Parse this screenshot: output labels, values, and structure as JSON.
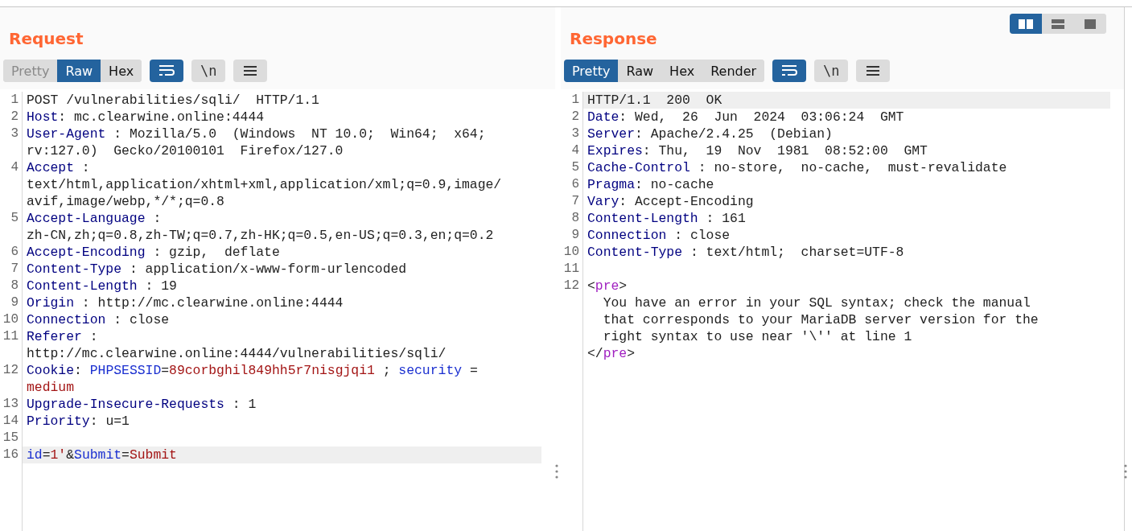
{
  "layout_toggle": [
    {
      "kind": "side-by-side",
      "selected": true
    },
    {
      "kind": "stacked",
      "selected": false
    },
    {
      "kind": "single",
      "selected": false
    }
  ],
  "panes": [
    {
      "title": "Request",
      "view_tabs": [
        {
          "label": "Pretty",
          "selected": false,
          "disabled": true
        },
        {
          "label": "Raw",
          "selected": true,
          "disabled": false
        },
        {
          "label": "Hex",
          "selected": false,
          "disabled": false
        }
      ],
      "tools": [
        {
          "kind": "wrap",
          "selected": true
        },
        {
          "kind": "newline",
          "label": "\\n",
          "selected": false
        },
        {
          "kind": "menu",
          "selected": false
        }
      ],
      "lines": [
        {
          "number": "1",
          "highlighted": false,
          "rows": [
            {
              "parts": [
                {
                  "kind": "plain",
                  "text": "POST /vulnerabilities/sqli/  HTTP/1.1"
                }
              ]
            }
          ]
        },
        {
          "number": "2",
          "highlighted": false,
          "rows": [
            {
              "parts": [
                {
                  "kind": "key",
                  "text": "Host"
                },
                {
                  "kind": "plain",
                  "text": ": mc.clearwine.online:4444"
                }
              ]
            }
          ]
        },
        {
          "number": "3",
          "highlighted": false,
          "rows": [
            {
              "parts": [
                {
                  "kind": "key",
                  "text": "User-Agent"
                },
                {
                  "kind": "plain",
                  "text": " : Mozilla/5.0  (Windows  NT 10.0;  Win64;  x64;"
                }
              ]
            },
            {
              "parts": [
                {
                  "kind": "plain",
                  "text": "rv:127.0)  Gecko/20100101  Firefox/127.0"
                }
              ]
            }
          ]
        },
        {
          "number": "4",
          "highlighted": false,
          "rows": [
            {
              "parts": [
                {
                  "kind": "key",
                  "text": "Accept"
                },
                {
                  "kind": "plain",
                  "text": " :"
                }
              ]
            },
            {
              "parts": [
                {
                  "kind": "plain",
                  "text": "text/html,application/xhtml+xml,application/xml;q=0.9,image/"
                }
              ]
            },
            {
              "parts": [
                {
                  "kind": "plain",
                  "text": "avif,image/webp,*/*;q=0.8"
                }
              ]
            }
          ]
        },
        {
          "number": "5",
          "highlighted": false,
          "rows": [
            {
              "parts": [
                {
                  "kind": "key",
                  "text": "Accept-Language"
                },
                {
                  "kind": "plain",
                  "text": " :"
                }
              ]
            },
            {
              "parts": [
                {
                  "kind": "plain",
                  "text": "zh-CN,zh;q=0.8,zh-TW;q=0.7,zh-HK;q=0.5,en-US;q=0.3,en;q=0.2"
                }
              ]
            }
          ]
        },
        {
          "number": "6",
          "highlighted": false,
          "rows": [
            {
              "parts": [
                {
                  "kind": "key",
                  "text": "Accept-Encoding"
                },
                {
                  "kind": "plain",
                  "text": " : gzip,  deflate"
                }
              ]
            }
          ]
        },
        {
          "number": "7",
          "highlighted": false,
          "rows": [
            {
              "parts": [
                {
                  "kind": "key",
                  "text": "Content-Type"
                },
                {
                  "kind": "plain",
                  "text": " : application/x-www-form-urlencoded"
                }
              ]
            }
          ]
        },
        {
          "number": "8",
          "highlighted": false,
          "rows": [
            {
              "parts": [
                {
                  "kind": "key",
                  "text": "Content-Length"
                },
                {
                  "kind": "plain",
                  "text": " : 19"
                }
              ]
            }
          ]
        },
        {
          "number": "9",
          "highlighted": false,
          "rows": [
            {
              "parts": [
                {
                  "kind": "key",
                  "text": "Origin"
                },
                {
                  "kind": "plain",
                  "text": " : http://mc.clearwine.online:4444"
                }
              ]
            }
          ]
        },
        {
          "number": "10",
          "highlighted": false,
          "rows": [
            {
              "parts": [
                {
                  "kind": "key",
                  "text": "Connection"
                },
                {
                  "kind": "plain",
                  "text": " : close"
                }
              ]
            }
          ]
        },
        {
          "number": "11",
          "highlighted": false,
          "rows": [
            {
              "parts": [
                {
                  "kind": "key",
                  "text": "Referer"
                },
                {
                  "kind": "plain",
                  "text": " :"
                }
              ]
            },
            {
              "parts": [
                {
                  "kind": "plain",
                  "text": "http://mc.clearwine.online:4444/vulnerabilities/sqli/"
                }
              ]
            }
          ]
        },
        {
          "number": "12",
          "highlighted": false,
          "rows": [
            {
              "parts": [
                {
                  "kind": "key",
                  "text": "Cookie"
                },
                {
                  "kind": "plain",
                  "text": ": "
                },
                {
                  "kind": "name",
                  "text": "PHPSESSID"
                },
                {
                  "kind": "plain",
                  "text": "="
                },
                {
                  "kind": "value",
                  "text": "89corbghil849hh5r7nisgjqi1"
                },
                {
                  "kind": "plain",
                  "text": " ; "
                },
                {
                  "kind": "name",
                  "text": "security"
                },
                {
                  "kind": "plain",
                  "text": " ="
                }
              ]
            },
            {
              "parts": [
                {
                  "kind": "value",
                  "text": "medium"
                }
              ]
            }
          ]
        },
        {
          "number": "13",
          "highlighted": false,
          "rows": [
            {
              "parts": [
                {
                  "kind": "key",
                  "text": "Upgrade-Insecure-Requests"
                },
                {
                  "kind": "plain",
                  "text": " : 1"
                }
              ]
            }
          ]
        },
        {
          "number": "14",
          "highlighted": false,
          "rows": [
            {
              "parts": [
                {
                  "kind": "key",
                  "text": "Priority"
                },
                {
                  "kind": "plain",
                  "text": ": u=1"
                }
              ]
            }
          ]
        },
        {
          "number": "15",
          "highlighted": false,
          "rows": [
            {
              "parts": []
            }
          ]
        },
        {
          "number": "16",
          "highlighted": true,
          "rows": [
            {
              "parts": [
                {
                  "kind": "name",
                  "text": "id"
                },
                {
                  "kind": "plain",
                  "text": "="
                },
                {
                  "kind": "value",
                  "text": "1'"
                },
                {
                  "kind": "plain",
                  "text": "&"
                },
                {
                  "kind": "name",
                  "text": "Submit"
                },
                {
                  "kind": "plain",
                  "text": "="
                },
                {
                  "kind": "value",
                  "text": "Submit"
                }
              ]
            }
          ]
        }
      ]
    },
    {
      "title": "Response",
      "view_tabs": [
        {
          "label": "Pretty",
          "selected": true,
          "disabled": false
        },
        {
          "label": "Raw",
          "selected": false,
          "disabled": false
        },
        {
          "label": "Hex",
          "selected": false,
          "disabled": false
        },
        {
          "label": "Render",
          "selected": false,
          "disabled": false
        }
      ],
      "tools": [
        {
          "kind": "wrap",
          "selected": true
        },
        {
          "kind": "newline",
          "label": "\\n",
          "selected": false
        },
        {
          "kind": "menu",
          "selected": false
        }
      ],
      "lines": [
        {
          "number": "1",
          "highlighted": true,
          "rows": [
            {
              "parts": [
                {
                  "kind": "plain",
                  "text": "HTTP/1.1  200  OK"
                }
              ]
            }
          ]
        },
        {
          "number": "2",
          "highlighted": false,
          "rows": [
            {
              "parts": [
                {
                  "kind": "key",
                  "text": "Date"
                },
                {
                  "kind": "plain",
                  "text": ": Wed,  26  Jun  2024  03:06:24  GMT"
                }
              ]
            }
          ]
        },
        {
          "number": "3",
          "highlighted": false,
          "rows": [
            {
              "parts": [
                {
                  "kind": "key",
                  "text": "Server"
                },
                {
                  "kind": "plain",
                  "text": ": Apache/2.4.25  (Debian)"
                }
              ]
            }
          ]
        },
        {
          "number": "4",
          "highlighted": false,
          "rows": [
            {
              "parts": [
                {
                  "kind": "key",
                  "text": "Expires"
                },
                {
                  "kind": "plain",
                  "text": ": Thu,  19  Nov  1981  08:52:00  GMT"
                }
              ]
            }
          ]
        },
        {
          "number": "5",
          "highlighted": false,
          "rows": [
            {
              "parts": [
                {
                  "kind": "key",
                  "text": "Cache-Control"
                },
                {
                  "kind": "plain",
                  "text": " : no-store,  no-cache,  must-revalidate"
                }
              ]
            }
          ]
        },
        {
          "number": "6",
          "highlighted": false,
          "rows": [
            {
              "parts": [
                {
                  "kind": "key",
                  "text": "Pragma"
                },
                {
                  "kind": "plain",
                  "text": ": no-cache"
                }
              ]
            }
          ]
        },
        {
          "number": "7",
          "highlighted": false,
          "rows": [
            {
              "parts": [
                {
                  "kind": "key",
                  "text": "Vary"
                },
                {
                  "kind": "plain",
                  "text": ": Accept-Encoding"
                }
              ]
            }
          ]
        },
        {
          "number": "8",
          "highlighted": false,
          "rows": [
            {
              "parts": [
                {
                  "kind": "key",
                  "text": "Content-Length"
                },
                {
                  "kind": "plain",
                  "text": " : 161"
                }
              ]
            }
          ]
        },
        {
          "number": "9",
          "highlighted": false,
          "rows": [
            {
              "parts": [
                {
                  "kind": "key",
                  "text": "Connection"
                },
                {
                  "kind": "plain",
                  "text": " : close"
                }
              ]
            }
          ]
        },
        {
          "number": "10",
          "highlighted": false,
          "rows": [
            {
              "parts": [
                {
                  "kind": "key",
                  "text": "Content-Type"
                },
                {
                  "kind": "plain",
                  "text": " : text/html;  charset=UTF-8"
                }
              ]
            }
          ]
        },
        {
          "number": "11",
          "highlighted": false,
          "rows": [
            {
              "parts": []
            }
          ]
        },
        {
          "number": "12",
          "highlighted": false,
          "rows": [
            {
              "parts": [
                {
                  "kind": "plain",
                  "text": "<"
                },
                {
                  "kind": "tag",
                  "text": "pre"
                },
                {
                  "kind": "plain",
                  "text": ">"
                }
              ]
            },
            {
              "parts": [
                {
                  "kind": "plain",
                  "text": "  You have an error in your SQL syntax; check the manual"
                }
              ]
            },
            {
              "parts": [
                {
                  "kind": "plain",
                  "text": "  that corresponds to your MariaDB server version for the"
                }
              ]
            },
            {
              "parts": [
                {
                  "kind": "plain",
                  "text": "  right syntax to use near '\\'' at line 1"
                }
              ]
            },
            {
              "parts": [
                {
                  "kind": "plain",
                  "text": "</"
                },
                {
                  "kind": "tag",
                  "text": "pre"
                },
                {
                  "kind": "plain",
                  "text": ">"
                }
              ]
            }
          ]
        }
      ]
    }
  ]
}
